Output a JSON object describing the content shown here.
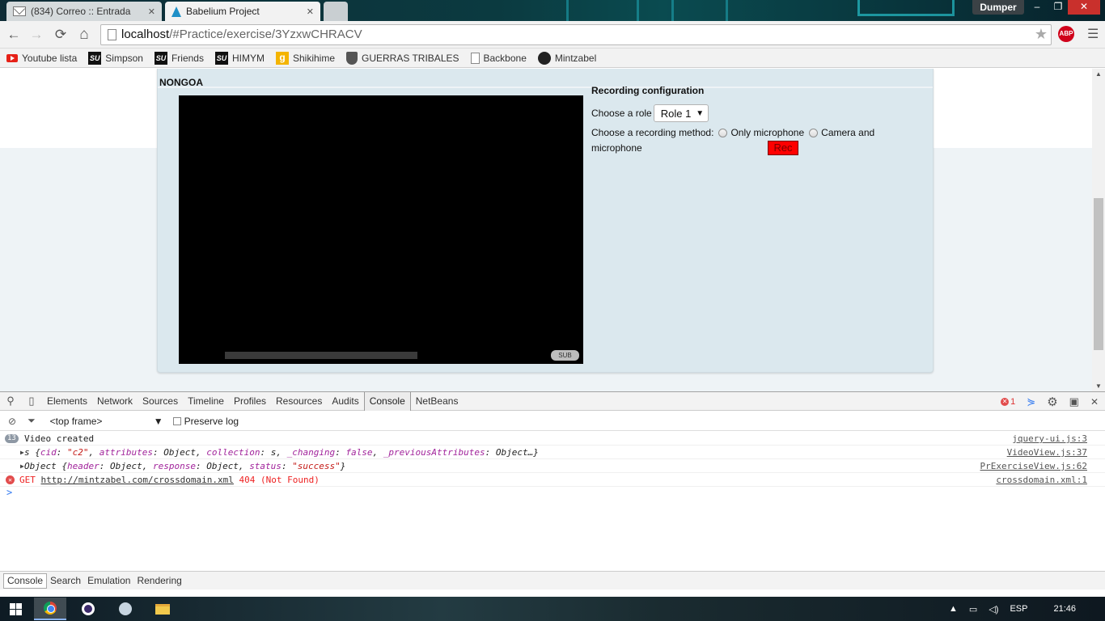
{
  "browser": {
    "tabs": [
      {
        "title": "(834) Correo :: Entrada",
        "close": "✕"
      },
      {
        "title": "Babelium Project",
        "close": "✕"
      }
    ],
    "user_badge": "Dumper",
    "window_controls": {
      "minimize": "–",
      "restore": "❐",
      "close": "✕"
    },
    "url": {
      "host": "localhost",
      "path": "/#Practice/exercise/3YzxwCHRACV"
    },
    "extension_abp": "ABP",
    "nav_icons": {
      "back": "←",
      "forward": "→",
      "reload": "⟳",
      "home": "⌂",
      "star": "★",
      "menu": "☰"
    }
  },
  "bookmarks": [
    {
      "label": "Youtube lista",
      "icon": "youtube-icon"
    },
    {
      "label": "Simpson",
      "icon": "su-icon"
    },
    {
      "label": "Friends",
      "icon": "su-icon"
    },
    {
      "label": "HIMYM",
      "icon": "su-icon"
    },
    {
      "label": "Shikihime",
      "icon": "g-icon"
    },
    {
      "label": "GUERRAS TRIBALES",
      "icon": "shield-icon"
    },
    {
      "label": "Backbone",
      "icon": "page-icon"
    },
    {
      "label": "Mintzabel",
      "icon": "github-icon"
    }
  ],
  "page": {
    "exercise_title": "NONGOA",
    "video": {
      "sub_button": "SUB"
    },
    "recording": {
      "title": "Recording configuration",
      "role_label": "Choose a role",
      "role_value": "Role 1",
      "method_label": "Choose a recording method:",
      "option_mic": "Only microphone",
      "option_cam_1": "Camera and",
      "option_cam_2": "microphone",
      "rec_button": "Rec"
    }
  },
  "devtools": {
    "tabs": [
      "Elements",
      "Network",
      "Sources",
      "Timeline",
      "Profiles",
      "Resources",
      "Audits",
      "Console",
      "NetBeans"
    ],
    "active_tab": "Console",
    "error_count": "1",
    "frame_selector": "<top frame>",
    "preserve_log": "Preserve log",
    "console": {
      "line1": {
        "count": "13",
        "text": "Video created",
        "source": "jquery-ui.js:3"
      },
      "line2": {
        "source": "VideoView.js:37"
      },
      "line3": {
        "source": "PrExerciseView.js:62"
      },
      "line4": {
        "method": "GET",
        "url": "http://mintzabel.com/crossdomain.xml",
        "status": "404 (Not Found)",
        "source": "crossdomain.xml:1"
      },
      "prompt": ">"
    },
    "drawer_tabs": [
      "Console",
      "Search",
      "Emulation",
      "Rendering"
    ]
  },
  "taskbar": {
    "lang": "ESP",
    "time": "21:46"
  },
  "colors": {
    "rec_button": "#ff0000",
    "panel_bg": "#dbe8ee",
    "error_text": "#ee2222"
  }
}
